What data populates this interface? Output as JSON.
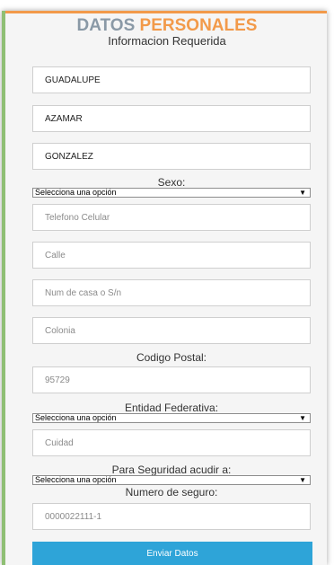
{
  "header": {
    "title_word1": "DATOS",
    "title_word2": "PERSONALES",
    "subtitle": "Informacion Requerida",
    "colors": {
      "accent_orange": "#f29a4a",
      "title_gray": "#8a99a6",
      "button_blue": "#2ea4d8"
    }
  },
  "form": {
    "nombre": {
      "value": "GUADALUPE"
    },
    "apellido_paterno": {
      "value": "AZAMAR"
    },
    "apellido_materno": {
      "value": "GONZALEZ"
    },
    "sexo": {
      "label": "Sexo:",
      "selected": "Selecciona una opción"
    },
    "telefono": {
      "placeholder": "Telefono Celular"
    },
    "calle": {
      "placeholder": "Calle"
    },
    "num_casa": {
      "placeholder": "Num de casa o S/n"
    },
    "colonia": {
      "placeholder": "Colonia"
    },
    "codigo_postal": {
      "label": "Codigo Postal:",
      "value": "95729"
    },
    "entidad": {
      "label": "Entidad Federativa:",
      "selected": "Selecciona una opción"
    },
    "ciudad": {
      "placeholder": "Cuidad"
    },
    "seguridad": {
      "label": "Para Seguridad acudir a:",
      "selected": "Selecciona una opción"
    },
    "numero_seguro": {
      "label": "Numero de seguro:",
      "value": "0000022111-1"
    },
    "submit_label": "Enviar Datos"
  }
}
